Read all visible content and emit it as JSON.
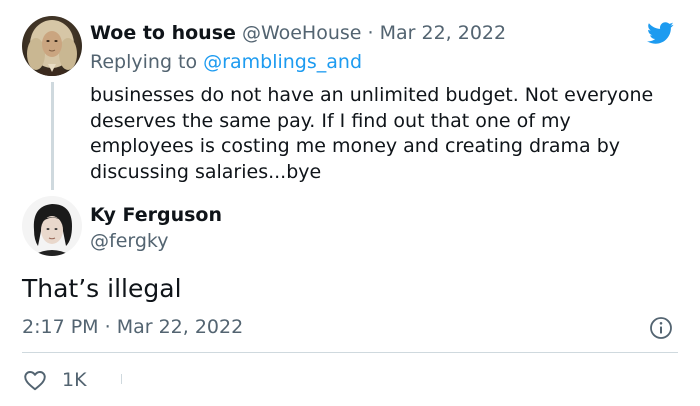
{
  "brand": {
    "accent_color": "#1d9bf0",
    "logo_icon": "twitter-bird-icon"
  },
  "parent_tweet": {
    "display_name": "Woe to house",
    "handle": "@WoeHouse",
    "separator": "·",
    "date": "Mar 22, 2022",
    "replying_prefix": "Replying to",
    "replying_to": "@ramblings_and",
    "text": "businesses do not have an unlimited budget.  Not everyone\ndeserves the same pay.  If I find out that one of my\nemployees is costing me money and creating drama by\ndiscussing salaries...bye",
    "avatar_icon": "portrait-avatar"
  },
  "main_tweet": {
    "display_name": "Ky Ferguson",
    "handle": "@fergky",
    "text": "That’s illegal",
    "time": "2:17 PM",
    "separator": "·",
    "date": "Mar 22, 2022",
    "avatar_icon": "portrait-avatar",
    "info_icon": "info-icon"
  },
  "actions": {
    "like_icon": "heart-icon",
    "like_count": "1K"
  }
}
